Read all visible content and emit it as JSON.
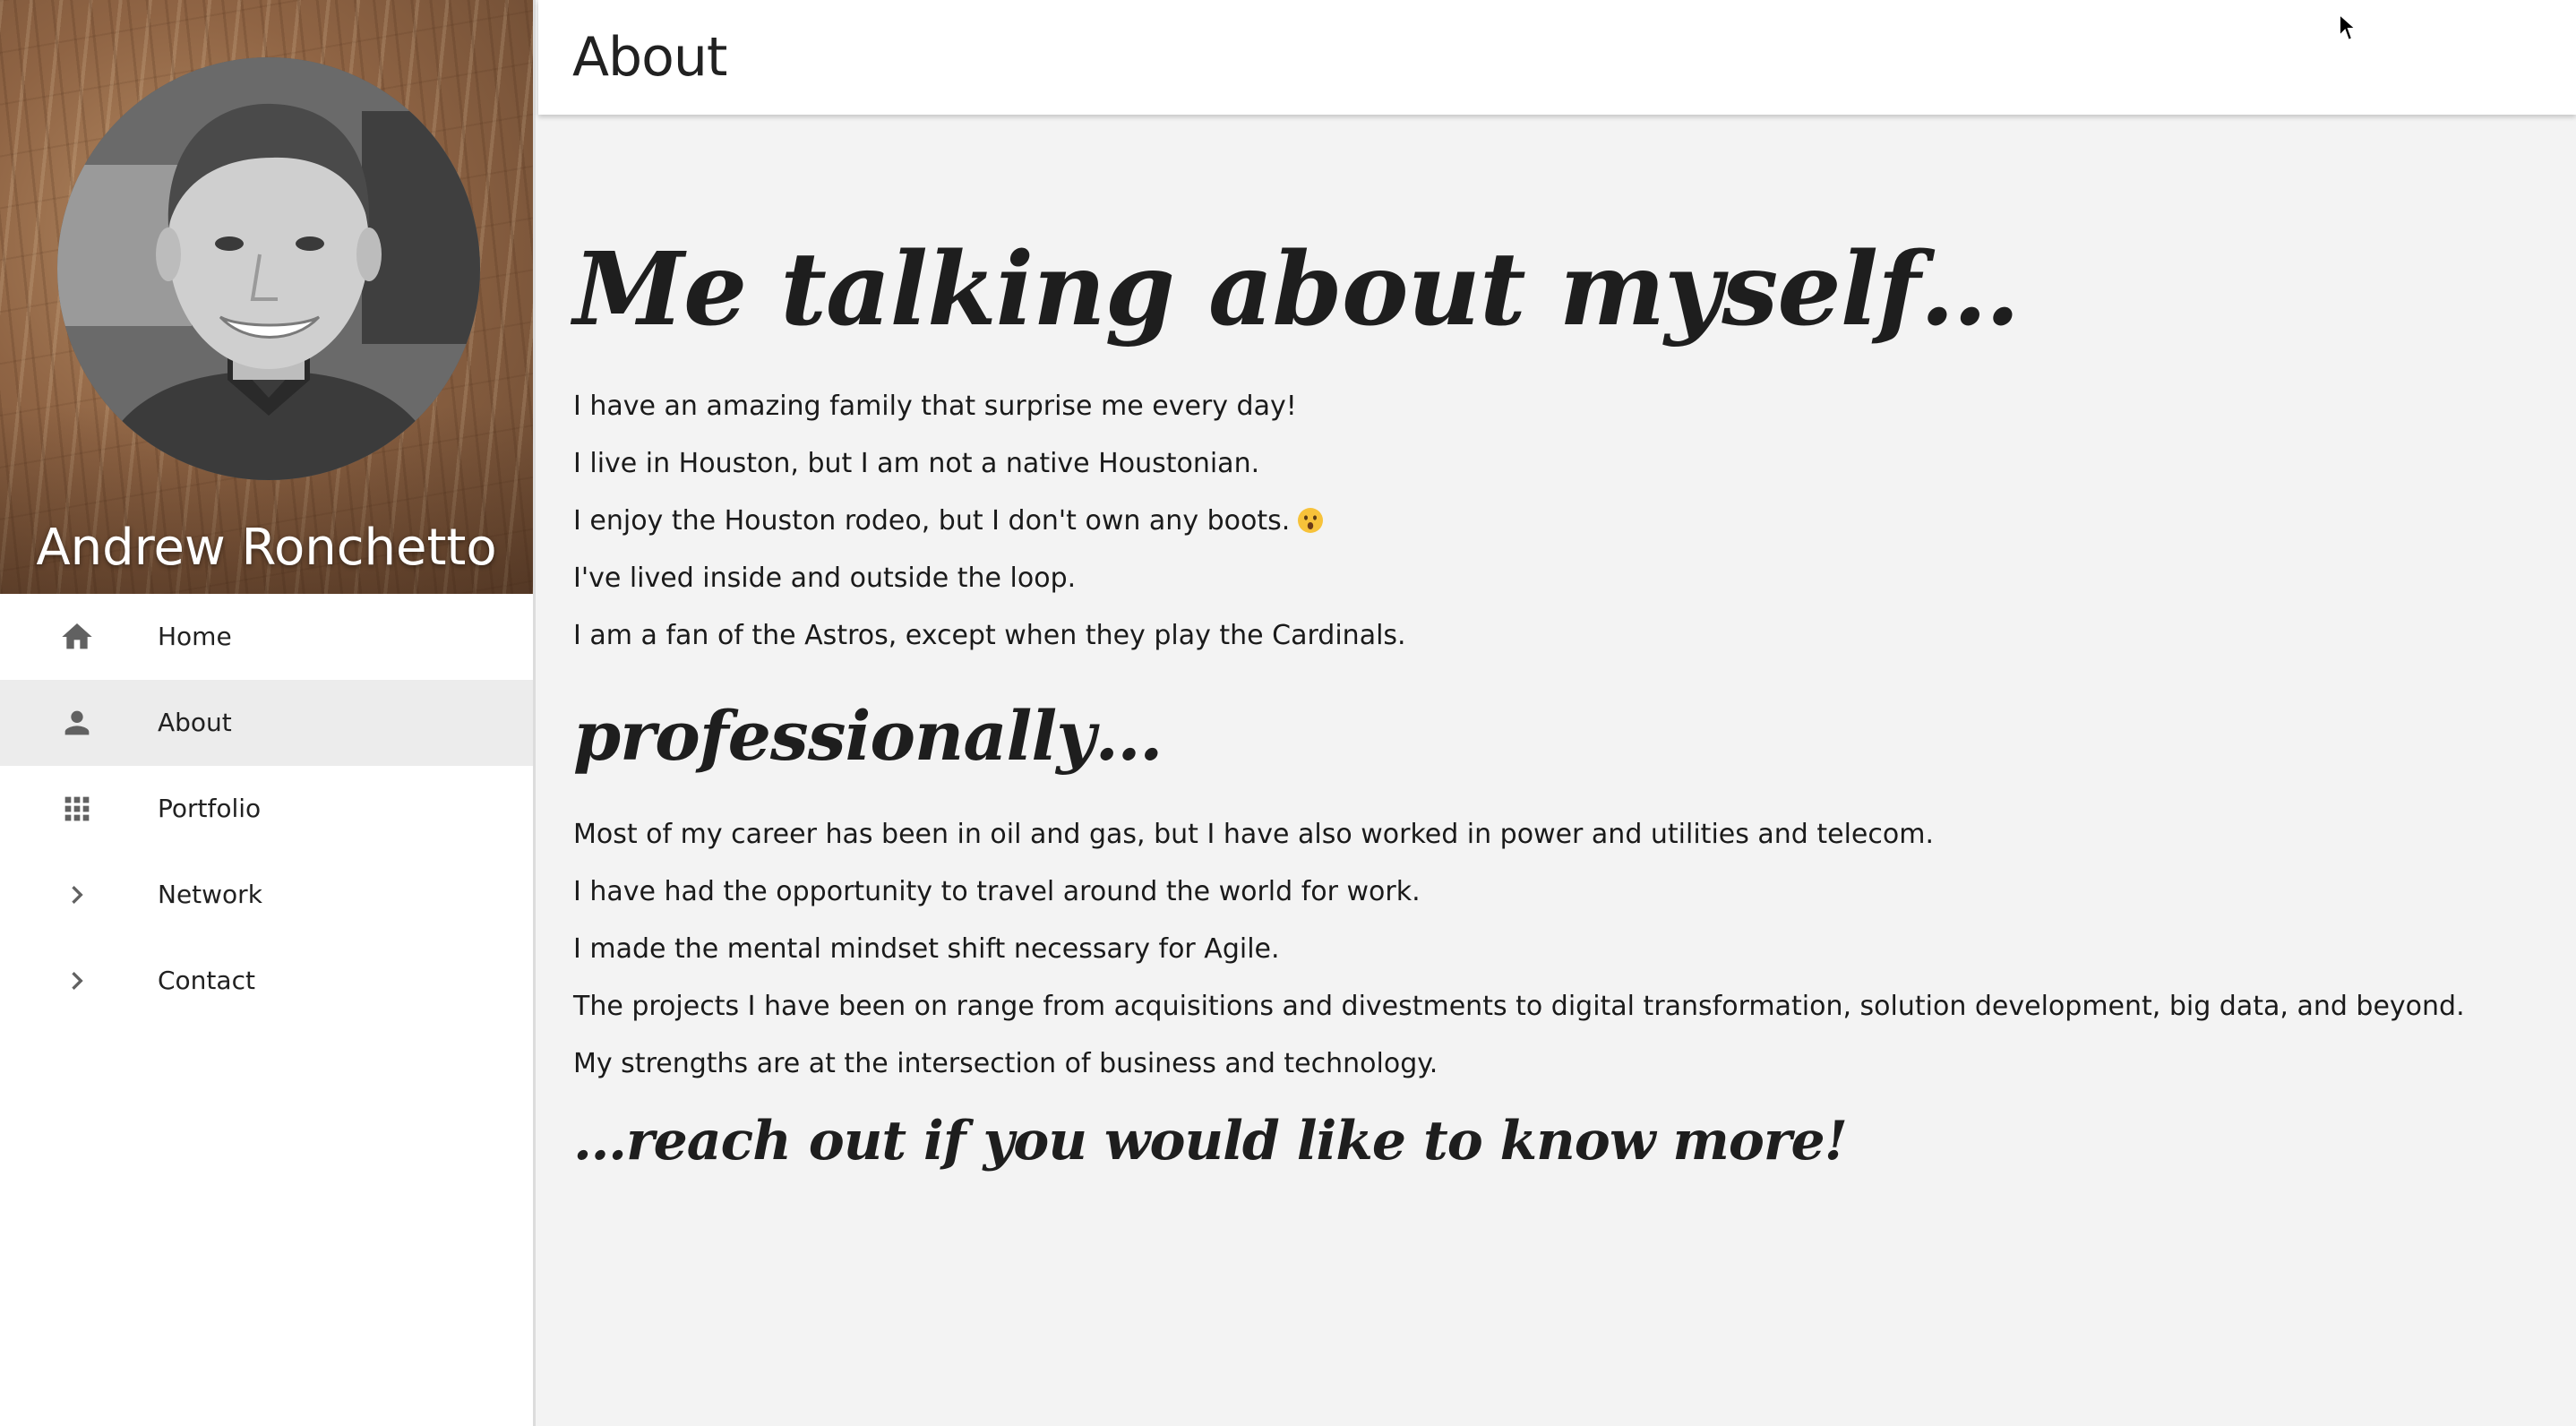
{
  "profile": {
    "name": "Andrew Ronchetto"
  },
  "nav": {
    "items": [
      {
        "label": "Home",
        "icon": "home-icon",
        "active": false
      },
      {
        "label": "About",
        "icon": "person-icon",
        "active": true
      },
      {
        "label": "Portfolio",
        "icon": "apps-grid-icon",
        "active": false
      },
      {
        "label": "Network",
        "icon": "chevron-right-icon",
        "active": false
      },
      {
        "label": "Contact",
        "icon": "chevron-right-icon",
        "active": false
      }
    ]
  },
  "header": {
    "title": "About"
  },
  "main": {
    "heading_personal": "Me talking about myself…",
    "personal": [
      "I have an amazing family that surprise me every day!",
      "I live in Houston, but I am not a native Houstonian.",
      "I enjoy the Houston rodeo, but I don't own any boots.",
      "I've lived inside and outside the loop.",
      "I am a fan of the Astros, except when they play the Cardinals."
    ],
    "heading_professional": "professionally…",
    "professional": [
      "Most of my career has been in oil and gas, but I have also worked in power and utilities and telecom.",
      "I have had the opportunity to travel around the world for work.",
      "I made the mental mindset shift necessary for Agile.",
      "The projects I have been on range from acquisitions and divestments to digital transformation, solution development, big data, and beyond.",
      "My strengths are at the intersection of business and technology."
    ],
    "heading_reach": "…reach out if you would like to know more!"
  },
  "colors": {
    "sidebar_bg": "#ffffff",
    "active_item_bg": "#ececec",
    "content_bg": "#f3f3f3",
    "text": "#212121",
    "icon": "#616161"
  }
}
